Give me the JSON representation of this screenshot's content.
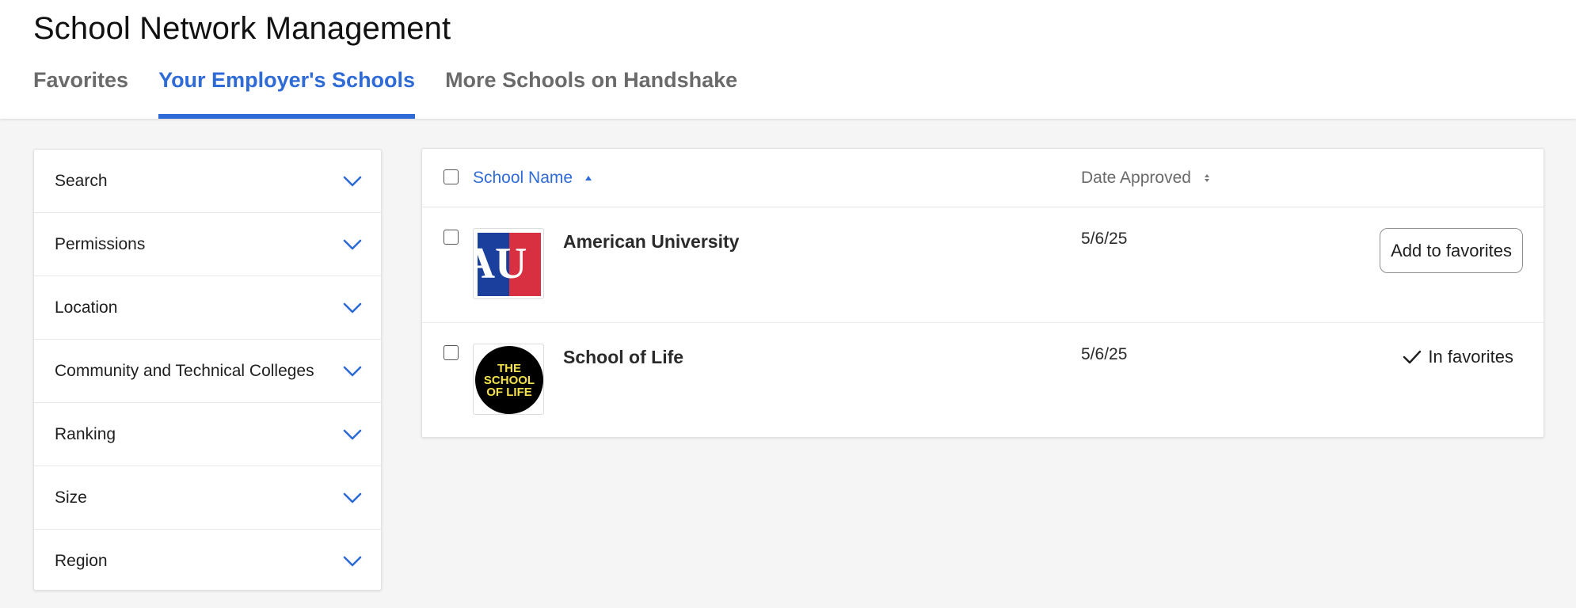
{
  "page": {
    "title": "School Network Management"
  },
  "tabs": [
    {
      "label": "Favorites",
      "active": false
    },
    {
      "label": "Your Employer's Schools",
      "active": true
    },
    {
      "label": "More Schools on Handshake",
      "active": false
    }
  ],
  "filters": [
    {
      "label": "Search"
    },
    {
      "label": "Permissions"
    },
    {
      "label": "Location"
    },
    {
      "label": "Community and Technical Colleges"
    },
    {
      "label": "Ranking"
    },
    {
      "label": "Size"
    },
    {
      "label": "Region"
    }
  ],
  "table": {
    "columns": {
      "name": "School Name",
      "date": "Date Approved"
    },
    "rows": [
      {
        "name": "American University",
        "date": "5/6/25",
        "action": "Add to favorites",
        "logo_letters": "AU"
      },
      {
        "name": "School of Life",
        "date": "5/6/25",
        "status": "In favorites",
        "logo_lines": [
          "THE",
          "SCHOOL",
          "OF LIFE"
        ]
      }
    ]
  },
  "colors": {
    "accent": "#2f6bd6",
    "au_blue": "#1b3f9c",
    "au_red": "#d83040",
    "sol_yellow": "#f4e14a"
  }
}
